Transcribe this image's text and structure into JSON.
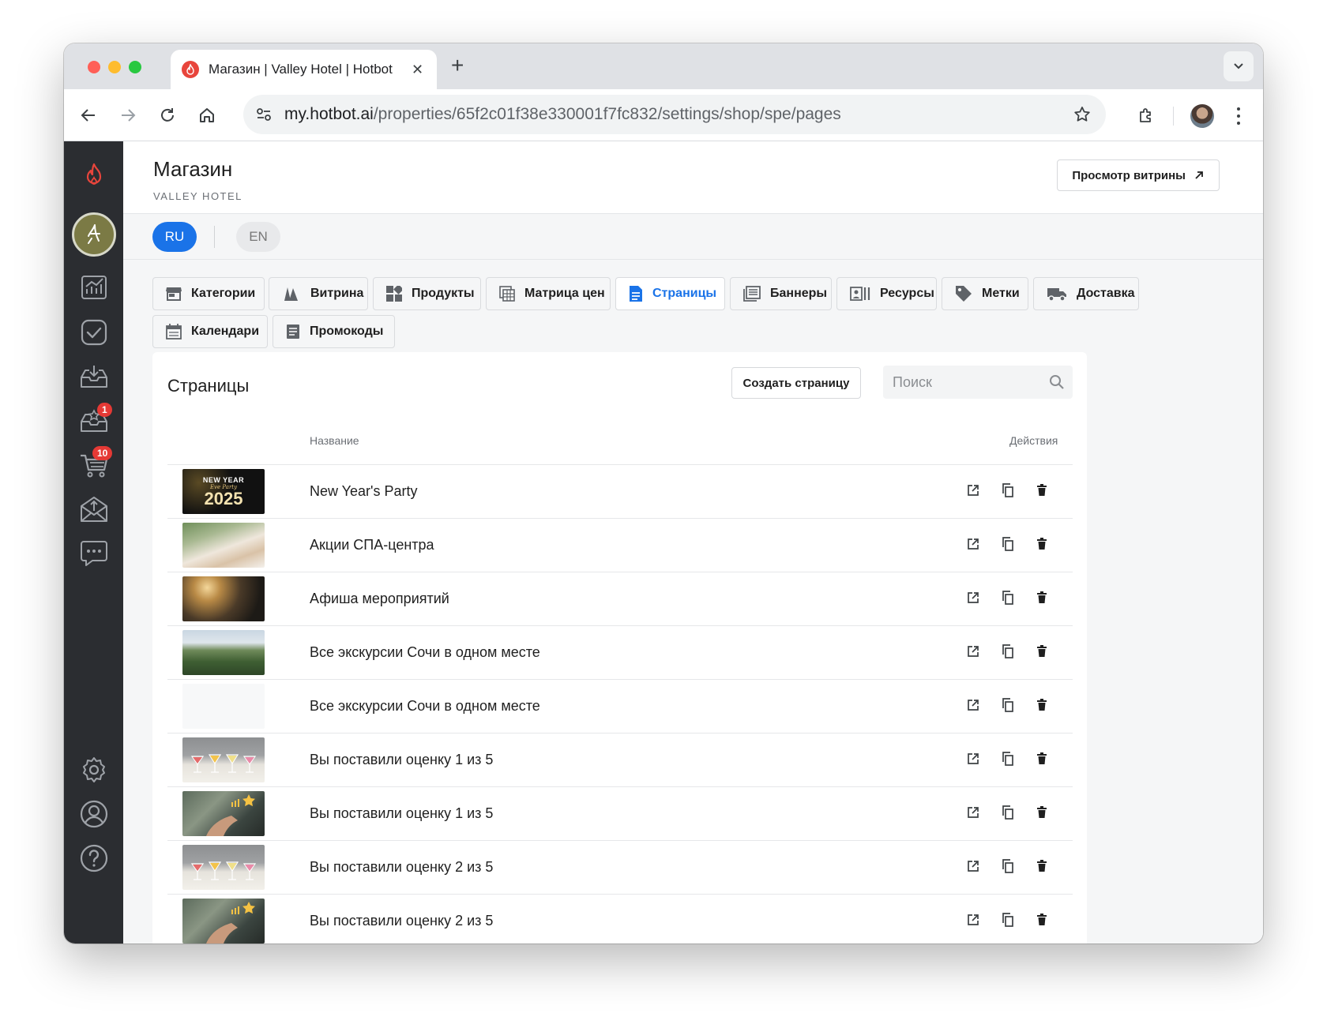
{
  "browser": {
    "tab_title": "Магазин | Valley Hotel | Hotbot",
    "url_host": "my.hotbot.ai",
    "url_path": "/properties/65f2c01f38e330001f7fc832/settings/shop/spe/pages"
  },
  "sidebar": {
    "badges": {
      "reviews": "1",
      "cart": "10"
    }
  },
  "header": {
    "title": "Магазин",
    "subtitle": "VALLEY HOTEL",
    "view_storefront_label": "Просмотр витрины"
  },
  "languages": [
    "RU",
    "EN"
  ],
  "tabs": [
    {
      "label": "Категории",
      "icon": "store-icon"
    },
    {
      "label": "Витрина",
      "icon": "storefront-icon"
    },
    {
      "label": "Продукты",
      "icon": "grid-icon"
    },
    {
      "label": "Матрица цен",
      "icon": "table-icon"
    },
    {
      "label": "Страницы",
      "icon": "page-icon",
      "active": true
    },
    {
      "label": "Баннеры",
      "icon": "banner-icon"
    },
    {
      "label": "Ресурсы",
      "icon": "resources-icon"
    },
    {
      "label": "Метки",
      "icon": "tag-icon"
    },
    {
      "label": "Доставка",
      "icon": "truck-icon"
    },
    {
      "label": "Календари",
      "icon": "calendar-icon"
    },
    {
      "label": "Промокоды",
      "icon": "promo-icon"
    }
  ],
  "pages": {
    "title": "Страницы",
    "create_label": "Создать страницу",
    "search_placeholder": "Поиск",
    "columns": {
      "name": "Название",
      "actions": "Действия"
    },
    "rows": [
      {
        "name": "New Year's Party",
        "thumb": "newyear",
        "thumb_line1": "NEW YEAR",
        "thumb_line2": "Eve Party",
        "thumb_year": "2025"
      },
      {
        "name": "Акции СПА-центра",
        "thumb": "spa"
      },
      {
        "name": "Афиша мероприятий",
        "thumb": "events"
      },
      {
        "name": "Все экскурсии Сочи в одном месте",
        "thumb": "mountains"
      },
      {
        "name": "Все экскурсии Сочи в одном месте",
        "thumb": "blank"
      },
      {
        "name": "Вы поставили оценку 1 из 5",
        "thumb": "cocktails"
      },
      {
        "name": "Вы поставили оценку 1 из 5",
        "thumb": "rating"
      },
      {
        "name": "Вы поставили оценку 2 из 5",
        "thumb": "cocktails"
      },
      {
        "name": "Вы поставили оценку 2 из 5",
        "thumb": "rating"
      }
    ]
  },
  "colors": {
    "accent": "#1a73e8",
    "sidebar_bg": "#2b2d31",
    "brand_red": "#e8453c",
    "badge_red": "#e53935"
  }
}
